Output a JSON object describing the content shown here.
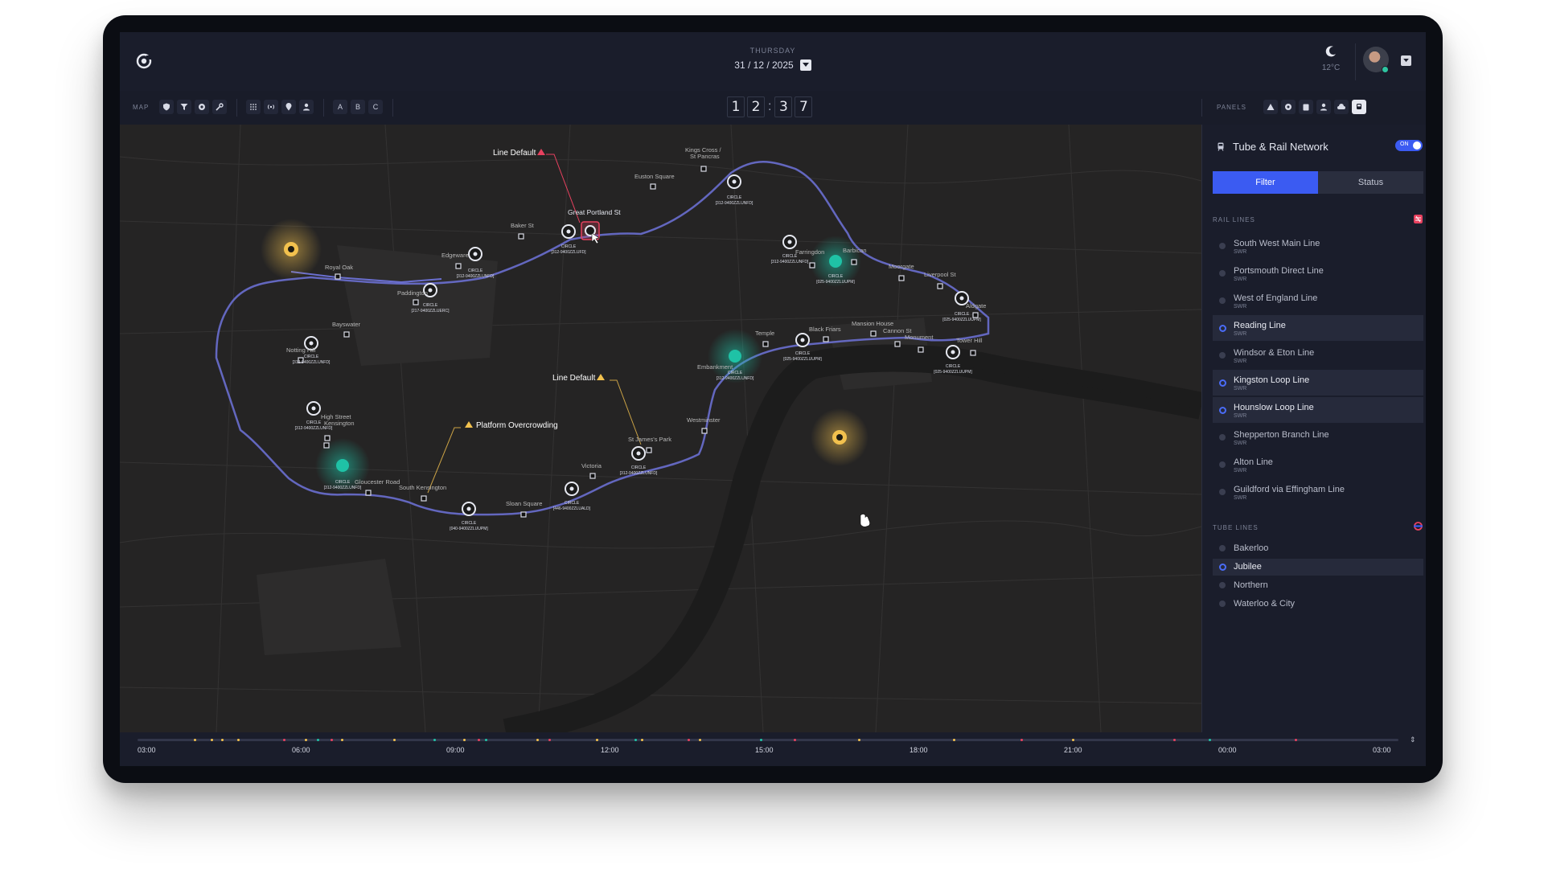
{
  "header": {
    "day": "THURSDAY",
    "date": "31 / 12 / 2025",
    "temperature": "12°C"
  },
  "toolbar": {
    "map_label": "MAP",
    "letters": [
      "A",
      "B",
      "C"
    ],
    "clock": [
      "1",
      "2",
      "3",
      "7"
    ],
    "panels_label": "PANELS"
  },
  "map": {
    "alerts": {
      "line_default_1": "Line Default",
      "line_default_2": "Line Default",
      "platform": "Platform Overcrowding"
    },
    "stations": [
      "Kings Cross /",
      "St Pancras",
      "Euston Square",
      "Great Portland St",
      "Baker St",
      "Edgeware",
      "Royal Oak",
      "Paddington",
      "Bayswater",
      "Notting Hill",
      "High Street",
      "Kensington",
      "Gloucester Road",
      "South Kensington",
      "Sloan Square",
      "Victoria",
      "St James's Park",
      "Westminster",
      "Embankment",
      "Temple",
      "Black Friars",
      "Mansion House",
      "Cannon St",
      "Monument",
      "Tower Hill",
      "Farringdon",
      "Barbican",
      "Moorgate",
      "Liverpool St",
      "Aldgate"
    ],
    "circle_label": "CIRCLE",
    "codes": [
      "[312-9400ZZLUNFD]",
      "[217-9400ZZLUERC]",
      "[025-9400ZZLUUPM]",
      "[040-9400ZZLUUPM]",
      "[446-9400ZZLUALD]",
      "[312-9400ZZLUFD]"
    ]
  },
  "panel": {
    "title": "Tube & Rail Network",
    "toggle_label": "ON",
    "tabs": [
      "Filter",
      "Status"
    ],
    "rail_title": "RAIL LINES",
    "rail_lines": [
      {
        "name": "South West Main Line",
        "sub": "SWR",
        "selected": false
      },
      {
        "name": "Portsmouth Direct Line",
        "sub": "SWR",
        "selected": false
      },
      {
        "name": "West of England Line",
        "sub": "SWR",
        "selected": false
      },
      {
        "name": "Reading Line",
        "sub": "SWR",
        "selected": true
      },
      {
        "name": "Windsor & Eton Line",
        "sub": "SWR",
        "selected": false
      },
      {
        "name": "Kingston Loop Line",
        "sub": "SWR",
        "selected": true
      },
      {
        "name": "Hounslow Loop Line",
        "sub": "SWR",
        "selected": true
      },
      {
        "name": "Shepperton Branch Line",
        "sub": "SWR",
        "selected": false
      },
      {
        "name": "Alton Line",
        "sub": "SWR",
        "selected": false
      },
      {
        "name": "Guildford via Effingham Line",
        "sub": "SWR",
        "selected": false
      }
    ],
    "tube_title": "TUBE LINES",
    "tube_lines": [
      {
        "name": "Bakerloo",
        "selected": false
      },
      {
        "name": "Jubilee",
        "selected": true
      },
      {
        "name": "Northern",
        "selected": false
      },
      {
        "name": "Waterloo & City",
        "selected": false
      }
    ]
  },
  "timeline": {
    "labels": [
      "03:00",
      "06:00",
      "09:00",
      "12:00",
      "15:00",
      "18:00",
      "21:00",
      "00:00",
      "03:00"
    ]
  },
  "colors": {
    "accent": "#3b5bf2",
    "route": "#6a6fd0",
    "alert_red": "#e8415f",
    "alert_yellow": "#f2c14e",
    "teal": "#1fc2a6"
  }
}
